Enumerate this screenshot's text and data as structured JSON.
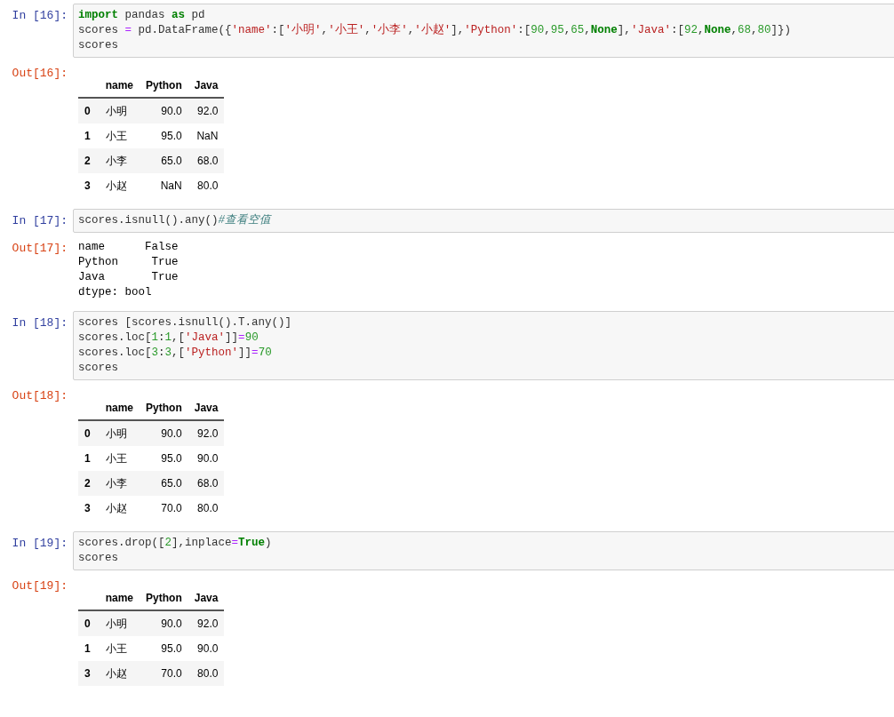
{
  "cells": [
    {
      "prompt": "In [16]:",
      "code": [
        [
          {
            "kind": "kw",
            "text": "import"
          },
          {
            "kind": "plain",
            "text": " pandas "
          },
          {
            "kind": "kw",
            "text": "as"
          },
          {
            "kind": "plain",
            "text": " pd"
          }
        ],
        [
          {
            "kind": "plain",
            "text": "scores "
          },
          {
            "kind": "op",
            "text": "="
          },
          {
            "kind": "plain",
            "text": " pd.DataFrame({"
          },
          {
            "kind": "str",
            "text": "'name'"
          },
          {
            "kind": "plain",
            "text": ":["
          },
          {
            "kind": "str",
            "text": "'小明'"
          },
          {
            "kind": "plain",
            "text": ","
          },
          {
            "kind": "str",
            "text": "'小王'"
          },
          {
            "kind": "plain",
            "text": ","
          },
          {
            "kind": "str",
            "text": "'小李'"
          },
          {
            "kind": "plain",
            "text": ","
          },
          {
            "kind": "str",
            "text": "'小赵'"
          },
          {
            "kind": "plain",
            "text": "],"
          },
          {
            "kind": "str",
            "text": "'Python'"
          },
          {
            "kind": "plain",
            "text": ":["
          },
          {
            "kind": "num",
            "text": "90"
          },
          {
            "kind": "plain",
            "text": ","
          },
          {
            "kind": "num",
            "text": "95"
          },
          {
            "kind": "plain",
            "text": ","
          },
          {
            "kind": "num",
            "text": "65"
          },
          {
            "kind": "plain",
            "text": ","
          },
          {
            "kind": "kw",
            "text": "None"
          },
          {
            "kind": "plain",
            "text": "],"
          },
          {
            "kind": "str",
            "text": "'Java'"
          },
          {
            "kind": "plain",
            "text": ":["
          },
          {
            "kind": "num",
            "text": "92"
          },
          {
            "kind": "plain",
            "text": ","
          },
          {
            "kind": "kw",
            "text": "None"
          },
          {
            "kind": "plain",
            "text": ","
          },
          {
            "kind": "num",
            "text": "68"
          },
          {
            "kind": "plain",
            "text": ","
          },
          {
            "kind": "num",
            "text": "80"
          },
          {
            "kind": "plain",
            "text": "]})"
          }
        ],
        [
          {
            "kind": "plain",
            "text": "scores"
          }
        ]
      ],
      "output": {
        "prompt": "Out[16]:",
        "kind": "table",
        "columns": [
          "name",
          "Python",
          "Java"
        ],
        "rows": [
          {
            "index": "0",
            "values": [
              "小明",
              "90.0",
              "92.0"
            ]
          },
          {
            "index": "1",
            "values": [
              "小王",
              "95.0",
              "NaN"
            ]
          },
          {
            "index": "2",
            "values": [
              "小李",
              "65.0",
              "68.0"
            ]
          },
          {
            "index": "3",
            "values": [
              "小赵",
              "NaN",
              "80.0"
            ]
          }
        ]
      }
    },
    {
      "prompt": "In [17]:",
      "code": [
        [
          {
            "kind": "plain",
            "text": "scores.isnull().any()"
          },
          {
            "kind": "comment",
            "text": "#查看空值"
          }
        ]
      ],
      "output": {
        "prompt": "Out[17]:",
        "kind": "text",
        "lines": [
          "name      False",
          "Python     True",
          "Java       True",
          "dtype: bool"
        ]
      }
    },
    {
      "prompt": "In [18]:",
      "code": [
        [
          {
            "kind": "plain",
            "text": "scores [scores.isnull().T.any()]"
          }
        ],
        [
          {
            "kind": "plain",
            "text": "scores.loc["
          },
          {
            "kind": "num",
            "text": "1"
          },
          {
            "kind": "plain",
            "text": ":"
          },
          {
            "kind": "num",
            "text": "1"
          },
          {
            "kind": "plain",
            "text": ",["
          },
          {
            "kind": "str",
            "text": "'Java'"
          },
          {
            "kind": "plain",
            "text": "]]"
          },
          {
            "kind": "op",
            "text": "="
          },
          {
            "kind": "num",
            "text": "90"
          }
        ],
        [
          {
            "kind": "plain",
            "text": "scores.loc["
          },
          {
            "kind": "num",
            "text": "3"
          },
          {
            "kind": "plain",
            "text": ":"
          },
          {
            "kind": "num",
            "text": "3"
          },
          {
            "kind": "plain",
            "text": ",["
          },
          {
            "kind": "str",
            "text": "'Python'"
          },
          {
            "kind": "plain",
            "text": "]]"
          },
          {
            "kind": "op",
            "text": "="
          },
          {
            "kind": "num",
            "text": "70"
          }
        ],
        [
          {
            "kind": "plain",
            "text": "scores"
          }
        ]
      ],
      "output": {
        "prompt": "Out[18]:",
        "kind": "table",
        "columns": [
          "name",
          "Python",
          "Java"
        ],
        "rows": [
          {
            "index": "0",
            "values": [
              "小明",
              "90.0",
              "92.0"
            ]
          },
          {
            "index": "1",
            "values": [
              "小王",
              "95.0",
              "90.0"
            ]
          },
          {
            "index": "2",
            "values": [
              "小李",
              "65.0",
              "68.0"
            ]
          },
          {
            "index": "3",
            "values": [
              "小赵",
              "70.0",
              "80.0"
            ]
          }
        ]
      }
    },
    {
      "prompt": "In [19]:",
      "code": [
        [
          {
            "kind": "plain",
            "text": "scores.drop(["
          },
          {
            "kind": "num",
            "text": "2"
          },
          {
            "kind": "plain",
            "text": "],inplace"
          },
          {
            "kind": "op",
            "text": "="
          },
          {
            "kind": "kw",
            "text": "True"
          },
          {
            "kind": "plain",
            "text": ")"
          }
        ],
        [
          {
            "kind": "plain",
            "text": "scores"
          }
        ]
      ],
      "output": {
        "prompt": "Out[19]:",
        "kind": "table",
        "columns": [
          "name",
          "Python",
          "Java"
        ],
        "rows": [
          {
            "index": "0",
            "values": [
              "小明",
              "90.0",
              "92.0"
            ]
          },
          {
            "index": "1",
            "values": [
              "小王",
              "95.0",
              "90.0"
            ]
          },
          {
            "index": "3",
            "values": [
              "小赵",
              "70.0",
              "80.0"
            ]
          }
        ]
      }
    }
  ]
}
